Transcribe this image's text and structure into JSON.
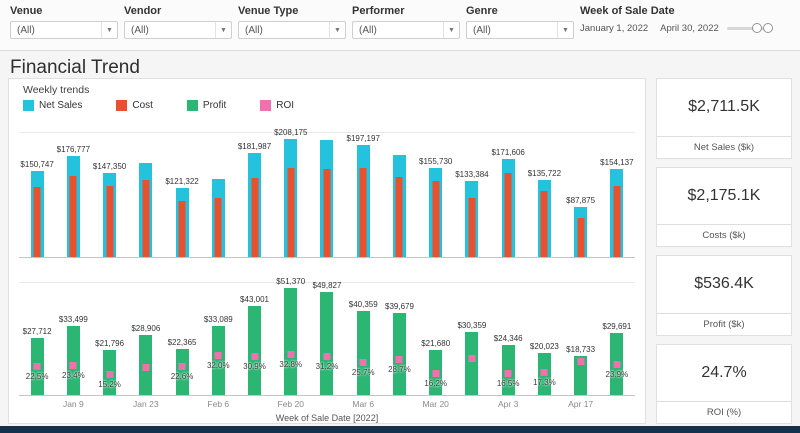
{
  "filters": [
    {
      "label": "Venue",
      "value": "(All)"
    },
    {
      "label": "Vendor",
      "value": "(All)"
    },
    {
      "label": "Venue Type",
      "value": "(All)"
    },
    {
      "label": "Performer",
      "value": "(All)"
    },
    {
      "label": "Genre",
      "value": "(All)"
    }
  ],
  "date_filter": {
    "label": "Week of Sale Date",
    "start": "January 1, 2022",
    "end": "April 30, 2022"
  },
  "header": {
    "title": "Financial Trend",
    "subtitle": "Weekly trends"
  },
  "legend": [
    {
      "label": "Net Sales",
      "color": "#25c2dd"
    },
    {
      "label": "Cost",
      "color": "#e8502e"
    },
    {
      "label": "Profit",
      "color": "#2bb673"
    },
    {
      "label": "ROI",
      "color": "#f071ae"
    }
  ],
  "kpis": [
    {
      "value": "$2,711.5K",
      "caption": "Net Sales ($k)"
    },
    {
      "value": "$2,175.1K",
      "caption": "Costs ($k)"
    },
    {
      "value": "$536.4K",
      "caption": "Profit ($k)"
    },
    {
      "value": "24.7%",
      "caption": "ROI (%)"
    }
  ],
  "chart_data": {
    "type": "bar",
    "title": "Financial Trend - Weekly trends",
    "x_axis_title": "Week of Sale Date [2022]",
    "x_ticks": [
      "Jan 9",
      "Jan 23",
      "Feb 6",
      "Feb 20",
      "Mar 6",
      "Mar 20",
      "Apr 3",
      "Apr 17"
    ],
    "net_axis_max": 218000,
    "profit_axis_max": 54000,
    "roi_axis_max": 100,
    "series_colors": {
      "net_sales": "#25c2dd",
      "cost": "#e8502e",
      "profit": "#2bb673",
      "roi": "#f071ae"
    },
    "weeks": [
      {
        "net_sales": 150747,
        "net_label": "$150,747",
        "cost": 123164,
        "profit": 27712,
        "profit_label": "$27,712",
        "roi": 22.5,
        "roi_label": "22.5%"
      },
      {
        "net_sales": 176777,
        "net_label": "$176,777",
        "cost": 143158,
        "profit": 33499,
        "profit_label": "$33,499",
        "roi": 23.4,
        "roi_label": "23.4%"
      },
      {
        "net_sales": 147350,
        "net_label": "$147,350",
        "cost": 125554,
        "profit": 21796,
        "profit_label": "$21,796",
        "roi": 15.2,
        "roi_label": "15.2%"
      },
      {
        "net_sales": 165000,
        "net_label": null,
        "cost": 136094,
        "profit": 28906,
        "profit_label": "$28,906",
        "roi": 21.2,
        "roi_label": null
      },
      {
        "net_sales": 121322,
        "net_label": "$121,322",
        "cost": 98957,
        "profit": 22365,
        "profit_label": "$22,365",
        "roi": 22.6,
        "roi_label": "22.6%"
      },
      {
        "net_sales": 136492,
        "net_label": null,
        "cost": 103403,
        "profit": 33089,
        "profit_label": "$33,089",
        "roi": 32.0,
        "roi_label": "32.0%"
      },
      {
        "net_sales": 181987,
        "net_label": "$181,987",
        "cost": 138986,
        "profit": 43001,
        "profit_label": "$43,001",
        "roi": 30.9,
        "roi_label": "30.9%"
      },
      {
        "net_sales": 208175,
        "net_label": "$208,175",
        "cost": 156805,
        "profit": 51370,
        "profit_label": "$51,370",
        "roi": 32.8,
        "roi_label": "32.8%"
      },
      {
        "net_sales": 205000,
        "net_label": null,
        "cost": 155173,
        "profit": 49827,
        "profit_label": "$49,827",
        "roi": 31.2,
        "roi_label": "31.2%"
      },
      {
        "net_sales": 197197,
        "net_label": "$197,197",
        "cost": 156838,
        "profit": 40359,
        "profit_label": "$40,359",
        "roi": 25.7,
        "roi_label": "25.7%"
      },
      {
        "net_sales": 180000,
        "net_label": null,
        "cost": 140321,
        "profit": 39679,
        "profit_label": "$39,679",
        "roi": 28.7,
        "roi_label": "28.7%"
      },
      {
        "net_sales": 155730,
        "net_label": "$155,730",
        "cost": 134050,
        "profit": 21680,
        "profit_label": "$21,680",
        "roi": 16.2,
        "roi_label": "16.2%"
      },
      {
        "net_sales": 133384,
        "net_label": "$133,384",
        "cost": 103025,
        "profit": 30359,
        "profit_label": "$30,359",
        "roi": 29.5,
        "roi_label": null
      },
      {
        "net_sales": 171606,
        "net_label": "$171,606",
        "cost": 147260,
        "profit": 24346,
        "profit_label": "$24,346",
        "roi": 16.5,
        "roi_label": "16.5%"
      },
      {
        "net_sales": 135722,
        "net_label": "$135,722",
        "cost": 115699,
        "profit": 20023,
        "profit_label": "$20,023",
        "roi": 17.3,
        "roi_label": "17.3%"
      },
      {
        "net_sales": 87875,
        "net_label": "$87,875",
        "cost": 69142,
        "profit": 18733,
        "profit_label": "$18,733",
        "roi": 27.1,
        "roi_label": null
      },
      {
        "net_sales": 154137,
        "net_label": "$154,137",
        "cost": 124446,
        "profit": 29691,
        "profit_label": "$29,691",
        "roi": 23.9,
        "roi_label": "23.9%"
      }
    ]
  }
}
